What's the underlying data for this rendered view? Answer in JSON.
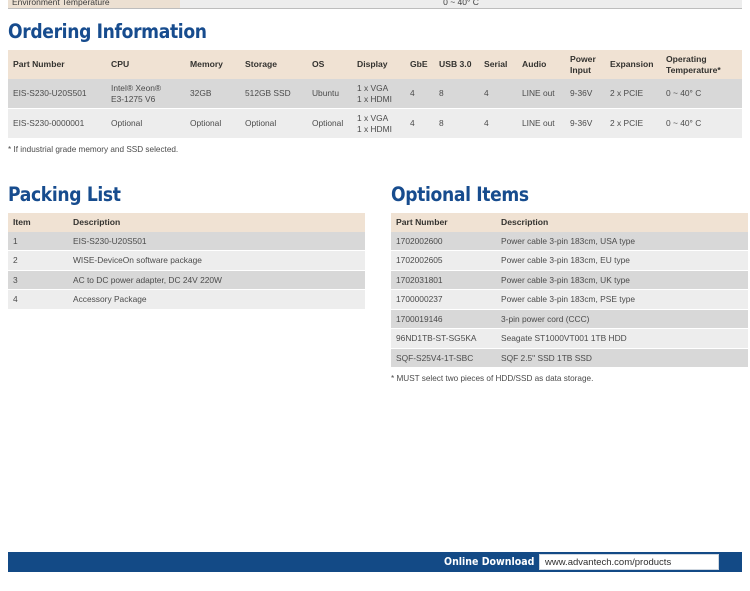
{
  "top_partial_row": {
    "label": "Environment Temperature",
    "value": "0 ~ 40° C"
  },
  "colors": {
    "heading_blue": "#174c8e",
    "table_header_peach": "#f0e2d3",
    "row_dark": "#d8d8d8",
    "row_light": "#ededed",
    "footer_blue": "#134a86"
  },
  "ordering": {
    "heading": "Ordering Information",
    "columns": [
      "Part Number",
      "CPU",
      "Memory",
      "Storage",
      "OS",
      "Display",
      "GbE",
      "USB 3.0",
      "Serial",
      "Audio",
      "Power Input",
      "Expansion",
      "Operating Temperature*"
    ],
    "rows": [
      {
        "part_number": "EIS-S230-U20S501",
        "cpu": "Intel® Xeon®\nE3-1275 V6",
        "memory": "32GB",
        "storage": "512GB SSD",
        "os": "Ubuntu",
        "display": "1 x VGA\n1 x HDMI",
        "gbe": "4",
        "usb3": "8",
        "serial": "4",
        "audio": "LINE out",
        "power_input": "9-36V",
        "expansion": "2 x PCIE",
        "operating_temperature": "0 ~ 40° C"
      },
      {
        "part_number": "EIS-S230-0000001",
        "cpu": "Optional",
        "memory": "Optional",
        "storage": "Optional",
        "os": "Optional",
        "display": "1 x VGA\n1 x HDMI",
        "gbe": "4",
        "usb3": "8",
        "serial": "4",
        "audio": "LINE out",
        "power_input": "9-36V",
        "expansion": "2 x PCIE",
        "operating_temperature": "0 ~ 40° C"
      }
    ],
    "note": "* If industrial grade memory and SSD selected."
  },
  "packing": {
    "heading": "Packing List",
    "columns": [
      "Item",
      "Description"
    ],
    "rows": [
      {
        "item": "1",
        "description": "EIS-S230-U20S501"
      },
      {
        "item": "2",
        "description": "WISE-DeviceOn software package"
      },
      {
        "item": "3",
        "description": "AC to DC power adapter, DC 24V 220W"
      },
      {
        "item": "4",
        "description": "Accessory Package"
      }
    ]
  },
  "optional": {
    "heading": "Optional Items",
    "columns": [
      "Part Number",
      "Description"
    ],
    "rows": [
      {
        "part_number": "1702002600",
        "description": "Power cable 3-pin 183cm, USA type"
      },
      {
        "part_number": "1702002605",
        "description": "Power cable 3-pin 183cm, EU type"
      },
      {
        "part_number": "1702031801",
        "description": "Power cable 3-pin 183cm, UK type"
      },
      {
        "part_number": "1700000237",
        "description": "Power cable 3-pin 183cm, PSE type"
      },
      {
        "part_number": "1700019146",
        "description": "3-pin power cord (CCC)"
      },
      {
        "part_number": "96ND1TB-ST-SG5KA",
        "description": "Seagate ST1000VT001 1TB HDD"
      },
      {
        "part_number": "SQF-S25V4-1T-SBC",
        "description": "SQF 2.5\" SSD 1TB SSD"
      }
    ],
    "note": "* MUST select two pieces of HDD/SSD as data storage."
  },
  "footer": {
    "label": "Online Download",
    "url": "www.advantech.com/products"
  }
}
